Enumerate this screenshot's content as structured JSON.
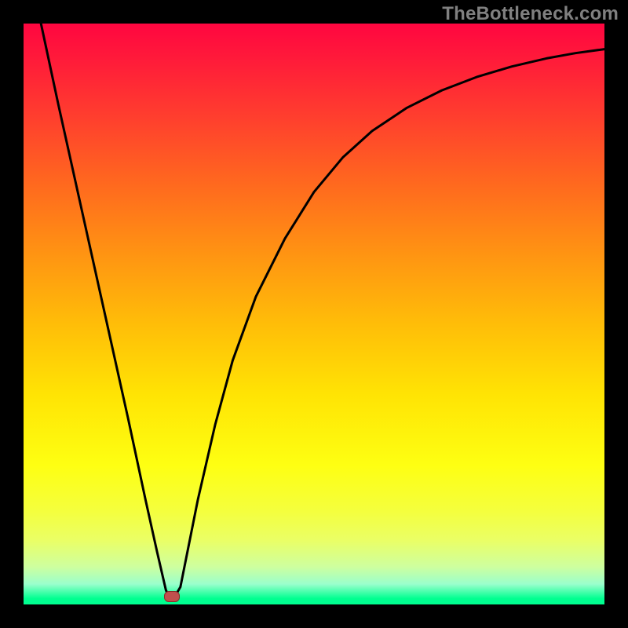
{
  "watermark": "TheBottleneck.com",
  "chart_data": {
    "type": "line",
    "title": "",
    "xlabel": "",
    "ylabel": "",
    "xlim": [
      0,
      100
    ],
    "ylim": [
      0,
      100
    ],
    "x": [
      3,
      6,
      10,
      14,
      18,
      21,
      23,
      24.5,
      25,
      26,
      27,
      28,
      30,
      33,
      36,
      40,
      45,
      50,
      55,
      60,
      66,
      72,
      78,
      84,
      90,
      95,
      100
    ],
    "values": [
      100,
      86,
      68,
      50,
      32,
      18,
      9,
      2.5,
      1.3,
      1.3,
      3,
      8,
      18,
      31,
      42,
      53,
      63,
      71,
      77,
      81.5,
      85.5,
      88.5,
      90.8,
      92.6,
      94,
      94.9,
      95.6
    ],
    "marker": {
      "x": 25.5,
      "y": 1.3
    },
    "gradient_stops": [
      {
        "pct": 0,
        "color": "#ff0640"
      },
      {
        "pct": 6,
        "color": "#ff1a3a"
      },
      {
        "pct": 16,
        "color": "#ff3e2e"
      },
      {
        "pct": 28,
        "color": "#ff6a1e"
      },
      {
        "pct": 40,
        "color": "#ff9512"
      },
      {
        "pct": 52,
        "color": "#ffbe08"
      },
      {
        "pct": 64,
        "color": "#ffe404"
      },
      {
        "pct": 76,
        "color": "#feff12"
      },
      {
        "pct": 84,
        "color": "#f4ff3e"
      },
      {
        "pct": 89,
        "color": "#eaff66"
      },
      {
        "pct": 93.5,
        "color": "#ceff9f"
      },
      {
        "pct": 96.5,
        "color": "#9affcc"
      },
      {
        "pct": 99,
        "color": "#00ff90"
      },
      {
        "pct": 100,
        "color": "#00ff90"
      }
    ],
    "curve_color": "#000000",
    "marker_color": "#c0504d"
  }
}
